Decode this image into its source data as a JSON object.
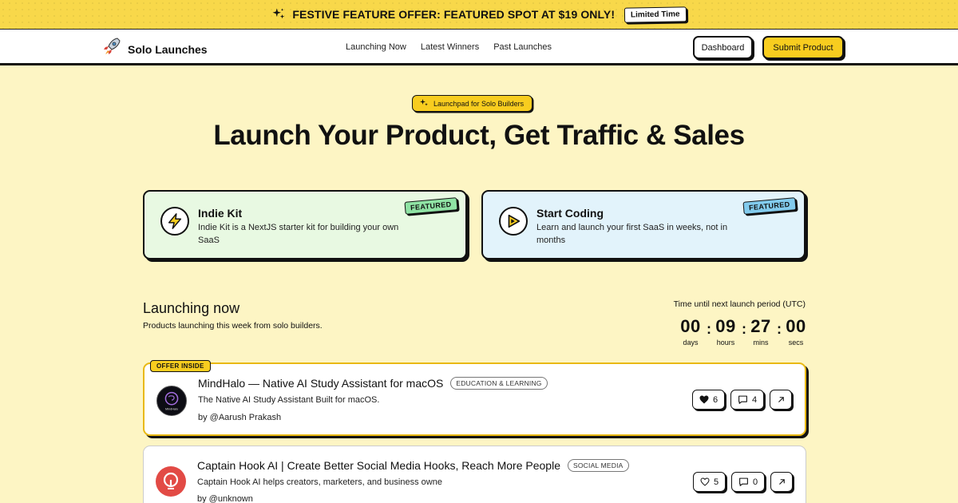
{
  "banner": {
    "text": "FESTIVE FEATURE OFFER: FEATURED SPOT AT $19 ONLY!",
    "badge": "Limited Time",
    "icon": "sparkles-icon"
  },
  "header": {
    "logo_text": "Solo Launches",
    "logo_icon": "rocket-icon",
    "nav": [
      "Launching Now",
      "Latest Winners",
      "Past Launches"
    ],
    "dashboard_label": "Dashboard",
    "submit_label": "Submit Product"
  },
  "hero": {
    "pill": "Launchpad for Solo Builders",
    "title": "Launch Your Product, Get Traffic & Sales"
  },
  "featured": [
    {
      "name": "Indie Kit",
      "description": "Indie Kit is a NextJS starter kit for building your own SaaS",
      "tag": "FEATURED",
      "icon": "lightning-icon",
      "bg": "#e8f9e2"
    },
    {
      "name": "Start Coding",
      "description": "Learn and launch your first SaaS in weeks, not in months",
      "tag": "FEATURED",
      "icon": "play-icon",
      "bg": "#e2f3fb"
    }
  ],
  "section": {
    "title": "Launching now",
    "subtitle": "Products launching this week from solo builders."
  },
  "timer": {
    "label": "Time until next launch period (UTC)",
    "units": [
      {
        "value": "00",
        "label": "days"
      },
      {
        "value": "09",
        "label": "hours"
      },
      {
        "value": "27",
        "label": "mins"
      },
      {
        "value": "00",
        "label": "secs"
      }
    ]
  },
  "products": [
    {
      "offer_tag": "OFFER INSIDE",
      "logo_text": "MindHalo",
      "title": "MindHalo — Native AI Study Assistant for macOS",
      "category": "EDUCATION & LEARNING",
      "description": "The Native AI Study Assistant Built for macOS.",
      "by": "by @Aarush Prakash",
      "votes": "6",
      "comments": "4"
    },
    {
      "title": "Captain Hook AI | Create Better Social Media Hooks, Reach More People",
      "category": "SOCIAL MEDIA",
      "description": "Captain Hook AI helps creators, marketers, and business owne",
      "by": "by @unknown",
      "votes": "5",
      "comments": "0"
    }
  ],
  "colors": {
    "page_bg": "#fdf5c4",
    "accent_yellow": "#f8cd1f",
    "banner_bg": "#f8d84a"
  }
}
